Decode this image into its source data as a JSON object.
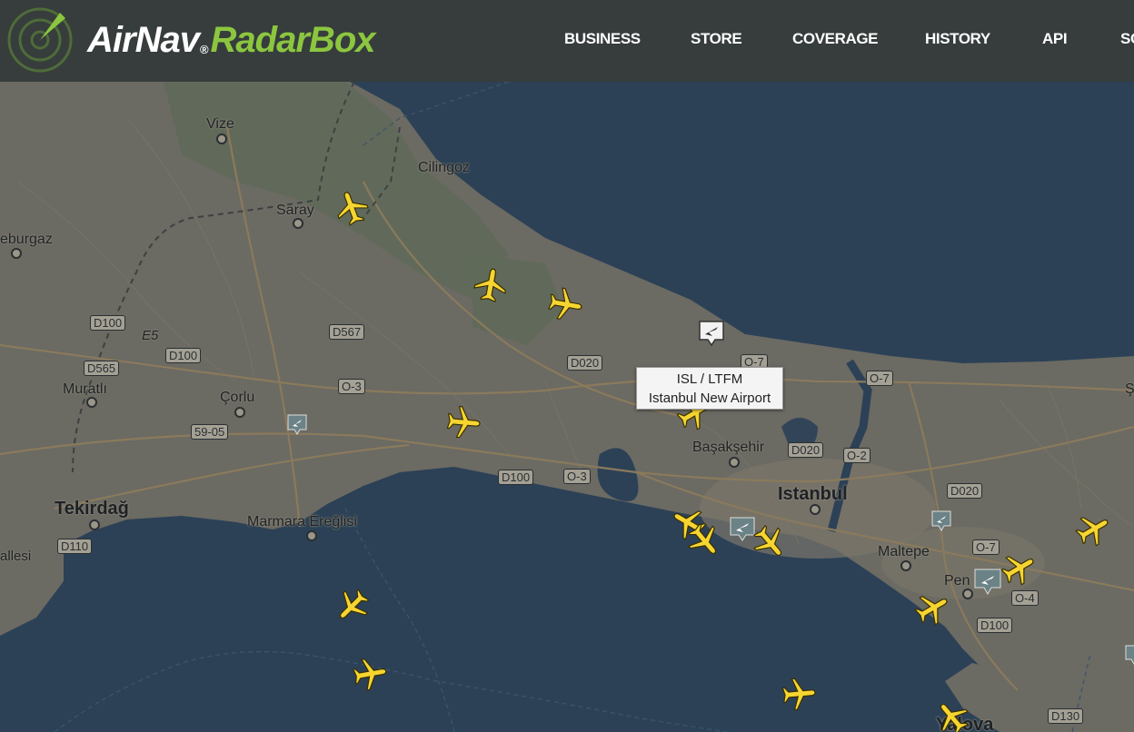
{
  "brand": {
    "airnav": "AirNav",
    "reg": "®",
    "radarbox": "RadarBox",
    "accent": "#8cc63f",
    "header_bg": "#363d3c"
  },
  "nav": [
    "BUSINESS",
    "STORE",
    "COVERAGE",
    "HISTORY",
    "API",
    "SO"
  ],
  "map": {
    "water_color": "#2c4156",
    "land_color": "#6b6a63",
    "places": [
      {
        "name": "Vize"
      },
      {
        "name": "Cilingoz"
      },
      {
        "name": "Saray"
      },
      {
        "name": "eburgaz"
      },
      {
        "name": "Muratlı"
      },
      {
        "name": "Çorlu"
      },
      {
        "name": "Tekirdağ"
      },
      {
        "name": "Marmara Ereğlisi"
      },
      {
        "name": "allesi"
      },
      {
        "name": "Başakşehir"
      },
      {
        "name": "Istanbul"
      },
      {
        "name": "Maltepe"
      },
      {
        "name": "Pen"
      },
      {
        "name": "Ş"
      },
      {
        "name": "Yalova"
      }
    ],
    "roads": [
      "D100",
      "E5",
      "D565",
      "D100",
      "D567",
      "O-3",
      "59-05",
      "D020",
      "D100",
      "O-3",
      "D110",
      "O-7",
      "O-7",
      "D020",
      "O-2",
      "D020",
      "O-7",
      "O-4",
      "D100",
      "D130"
    ]
  },
  "tooltip": {
    "code": "ISL / LTFM",
    "name": "Istanbul New Airport"
  },
  "icons": {
    "plane": "airplane-icon",
    "airport": "airport-marker-icon",
    "logo": "radar-logo-icon"
  }
}
